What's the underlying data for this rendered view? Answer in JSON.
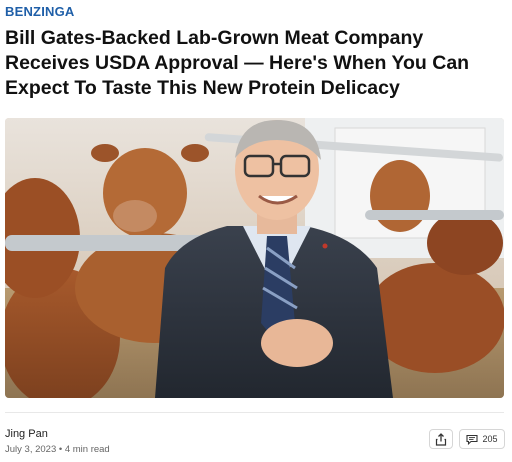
{
  "publisher": "BENZINGA",
  "headline": "Bill Gates-Backed Lab-Grown Meat Company Receives USDA Approval — Here's When You Can Expect To Taste This New Protein Delicacy",
  "byline": {
    "author": "Jing Pan",
    "date_read": "July 3, 2023 • 4 min read"
  },
  "actions": {
    "share_icon": "share-icon",
    "comment_icon": "comment-icon",
    "comment_count": "205"
  },
  "colors": {
    "publisher": "#1f5fa8"
  }
}
